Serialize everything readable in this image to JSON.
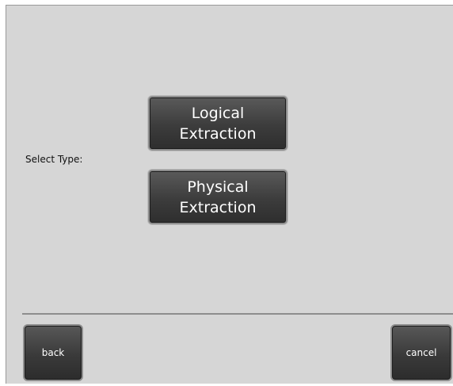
{
  "form": {
    "select_label": "Select Type:"
  },
  "options": [
    {
      "line1": "Logical",
      "line2": "Extraction"
    },
    {
      "line1": "Physical",
      "line2": "Extraction"
    }
  ],
  "footer": {
    "back_label": "back",
    "cancel_label": "cancel"
  },
  "colors": {
    "background": "#d6d6d6",
    "button_fill": "#3c3c3c",
    "button_border": "#8e8e8e",
    "button_text": "#ffffff"
  }
}
